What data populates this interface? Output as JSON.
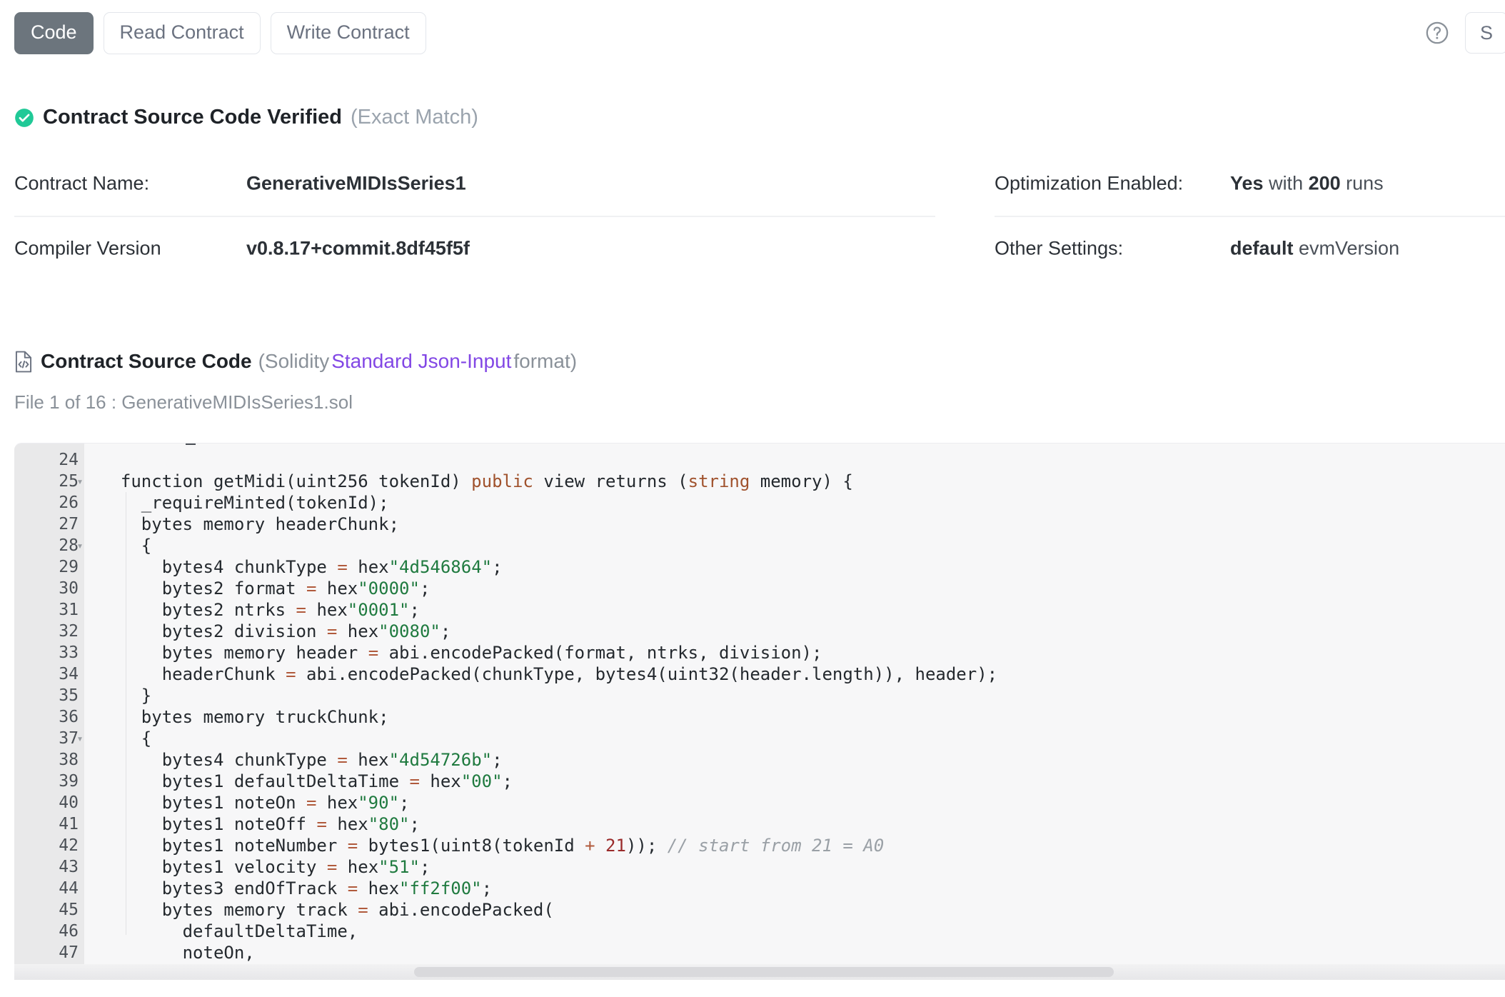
{
  "tabs": [
    {
      "label": "Code",
      "active": true
    },
    {
      "label": "Read Contract",
      "active": false
    },
    {
      "label": "Write Contract",
      "active": false
    }
  ],
  "toolbar": {
    "help_icon": "question-circle-icon",
    "right_button_label": "S"
  },
  "verified": {
    "badge_icon": "check-circle-icon",
    "title": "Contract Source Code Verified",
    "subtitle": "(Exact Match)",
    "badge_color": "#20c997"
  },
  "meta": {
    "left": [
      {
        "label": "Contract Name:",
        "value": "GenerativeMIDIsSeries1"
      },
      {
        "label": "Compiler Version",
        "value": "v0.8.17+commit.8df45f5f"
      }
    ],
    "right": [
      {
        "label": "Optimization Enabled:",
        "strong1": "Yes",
        "mid": " with ",
        "strong2": "200",
        "tail": " runs"
      },
      {
        "label": "Other Settings:",
        "strong1": "default",
        "mid": " evmVersion",
        "strong2": "",
        "tail": ""
      }
    ]
  },
  "source": {
    "icon": "file-code-icon",
    "title": "Contract Source Code",
    "paren_open": "(Solidity ",
    "link": "Standard Json-Input",
    "paren_close": " format)",
    "file_label": "File 1 of 16 : GenerativeMIDIsSeries1.sol",
    "link_color": "#8247e5"
  },
  "code": {
    "first_line": 24,
    "fold_lines": [
      25,
      28,
      37
    ],
    "lines": [
      {
        "n": 24,
        "tokens": []
      },
      {
        "n": 25,
        "tokens": [
          {
            "t": "  function getMidi(uint256 tokenId) ",
            "c": ""
          },
          {
            "t": "public",
            "c": "kw"
          },
          {
            "t": " view returns (",
            "c": ""
          },
          {
            "t": "string",
            "c": "typ"
          },
          {
            "t": " memory) {",
            "c": ""
          }
        ]
      },
      {
        "n": 26,
        "tokens": [
          {
            "t": "    _requireMinted(tokenId);",
            "c": ""
          }
        ]
      },
      {
        "n": 27,
        "tokens": [
          {
            "t": "    bytes memory headerChunk;",
            "c": ""
          }
        ]
      },
      {
        "n": 28,
        "tokens": [
          {
            "t": "    {",
            "c": ""
          }
        ]
      },
      {
        "n": 29,
        "tokens": [
          {
            "t": "      bytes4 chunkType ",
            "c": ""
          },
          {
            "t": "=",
            "c": "op"
          },
          {
            "t": " hex",
            "c": ""
          },
          {
            "t": "\"4d546864\"",
            "c": "s"
          },
          {
            "t": ";",
            "c": ""
          }
        ]
      },
      {
        "n": 30,
        "tokens": [
          {
            "t": "      bytes2 format ",
            "c": ""
          },
          {
            "t": "=",
            "c": "op"
          },
          {
            "t": " hex",
            "c": ""
          },
          {
            "t": "\"0000\"",
            "c": "s"
          },
          {
            "t": ";",
            "c": ""
          }
        ]
      },
      {
        "n": 31,
        "tokens": [
          {
            "t": "      bytes2 ntrks ",
            "c": ""
          },
          {
            "t": "=",
            "c": "op"
          },
          {
            "t": " hex",
            "c": ""
          },
          {
            "t": "\"0001\"",
            "c": "s"
          },
          {
            "t": ";",
            "c": ""
          }
        ]
      },
      {
        "n": 32,
        "tokens": [
          {
            "t": "      bytes2 division ",
            "c": ""
          },
          {
            "t": "=",
            "c": "op"
          },
          {
            "t": " hex",
            "c": ""
          },
          {
            "t": "\"0080\"",
            "c": "s"
          },
          {
            "t": ";",
            "c": ""
          }
        ]
      },
      {
        "n": 33,
        "tokens": [
          {
            "t": "      bytes memory header ",
            "c": ""
          },
          {
            "t": "=",
            "c": "op"
          },
          {
            "t": " abi.encodePacked(format, ntrks, division);",
            "c": ""
          }
        ]
      },
      {
        "n": 34,
        "tokens": [
          {
            "t": "      headerChunk ",
            "c": ""
          },
          {
            "t": "=",
            "c": "op"
          },
          {
            "t": " abi.encodePacked(chunkType, bytes4(uint32(header.length)), header);",
            "c": ""
          }
        ]
      },
      {
        "n": 35,
        "tokens": [
          {
            "t": "    }",
            "c": ""
          }
        ]
      },
      {
        "n": 36,
        "tokens": [
          {
            "t": "    bytes memory truckChunk;",
            "c": ""
          }
        ]
      },
      {
        "n": 37,
        "tokens": [
          {
            "t": "    {",
            "c": ""
          }
        ]
      },
      {
        "n": 38,
        "tokens": [
          {
            "t": "      bytes4 chunkType ",
            "c": ""
          },
          {
            "t": "=",
            "c": "op"
          },
          {
            "t": " hex",
            "c": ""
          },
          {
            "t": "\"4d54726b\"",
            "c": "s"
          },
          {
            "t": ";",
            "c": ""
          }
        ]
      },
      {
        "n": 39,
        "tokens": [
          {
            "t": "      bytes1 defaultDeltaTime ",
            "c": ""
          },
          {
            "t": "=",
            "c": "op"
          },
          {
            "t": " hex",
            "c": ""
          },
          {
            "t": "\"00\"",
            "c": "s"
          },
          {
            "t": ";",
            "c": ""
          }
        ]
      },
      {
        "n": 40,
        "tokens": [
          {
            "t": "      bytes1 noteOn ",
            "c": ""
          },
          {
            "t": "=",
            "c": "op"
          },
          {
            "t": " hex",
            "c": ""
          },
          {
            "t": "\"90\"",
            "c": "s"
          },
          {
            "t": ";",
            "c": ""
          }
        ]
      },
      {
        "n": 41,
        "tokens": [
          {
            "t": "      bytes1 noteOff ",
            "c": ""
          },
          {
            "t": "=",
            "c": "op"
          },
          {
            "t": " hex",
            "c": ""
          },
          {
            "t": "\"80\"",
            "c": "s"
          },
          {
            "t": ";",
            "c": ""
          }
        ]
      },
      {
        "n": 42,
        "tokens": [
          {
            "t": "      bytes1 noteNumber ",
            "c": ""
          },
          {
            "t": "=",
            "c": "op"
          },
          {
            "t": " bytes1(uint8(tokenId ",
            "c": ""
          },
          {
            "t": "+",
            "c": "op"
          },
          {
            "t": " ",
            "c": ""
          },
          {
            "t": "21",
            "c": "num"
          },
          {
            "t": ")); ",
            "c": ""
          },
          {
            "t": "// start from 21 = A0",
            "c": "cmt"
          }
        ]
      },
      {
        "n": 43,
        "tokens": [
          {
            "t": "      bytes1 velocity ",
            "c": ""
          },
          {
            "t": "=",
            "c": "op"
          },
          {
            "t": " hex",
            "c": ""
          },
          {
            "t": "\"51\"",
            "c": "s"
          },
          {
            "t": ";",
            "c": ""
          }
        ]
      },
      {
        "n": 44,
        "tokens": [
          {
            "t": "      bytes3 endOfTrack ",
            "c": ""
          },
          {
            "t": "=",
            "c": "op"
          },
          {
            "t": " hex",
            "c": ""
          },
          {
            "t": "\"ff2f00\"",
            "c": "s"
          },
          {
            "t": ";",
            "c": ""
          }
        ]
      },
      {
        "n": 45,
        "tokens": [
          {
            "t": "      bytes memory track ",
            "c": ""
          },
          {
            "t": "=",
            "c": "op"
          },
          {
            "t": " abi.encodePacked(",
            "c": ""
          }
        ]
      },
      {
        "n": 46,
        "tokens": [
          {
            "t": "        defaultDeltaTime,",
            "c": ""
          }
        ]
      },
      {
        "n": 47,
        "tokens": [
          {
            "t": "        noteOn,",
            "c": ""
          }
        ]
      }
    ]
  }
}
